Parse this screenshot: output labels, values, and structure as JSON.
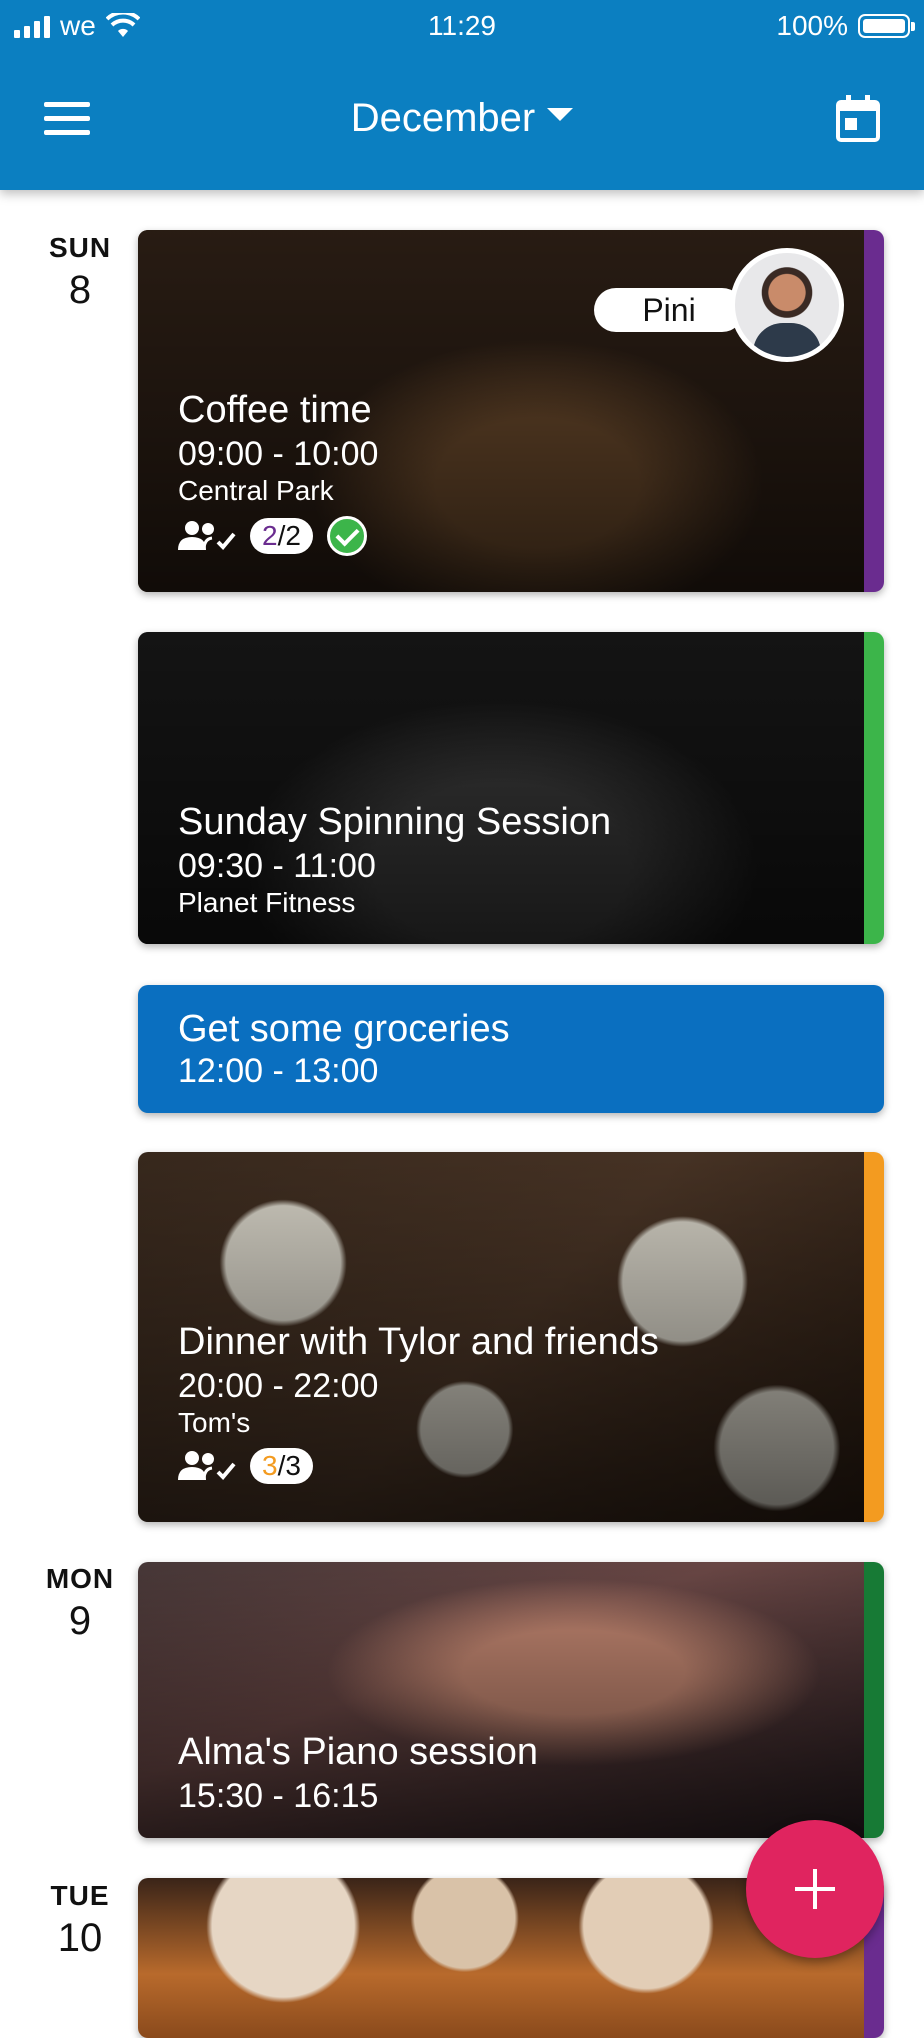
{
  "status_bar": {
    "carrier": "we",
    "time": "11:29",
    "battery": "100%"
  },
  "header": {
    "month": "December",
    "menu_icon": "menu-icon",
    "calendar_icon": "calendar-icon"
  },
  "days": [
    {
      "dow": "SUN",
      "num": "8"
    },
    {
      "dow": "MON",
      "num": "9"
    },
    {
      "dow": "TUE",
      "num": "10"
    }
  ],
  "events": [
    {
      "title": "Coffee time",
      "time": "09:00 - 10:00",
      "place": "Central Park",
      "owner": "Pini",
      "attendees_going": "2",
      "attendees_total": "/2",
      "color": "#6a2c8f"
    },
    {
      "title": "Sunday Spinning Session",
      "time": "09:30 - 11:00",
      "place": "Planet Fitness",
      "color": "#3cb54a"
    },
    {
      "title": "Get some groceries",
      "time": "12:00 - 13:00",
      "color": "#0a6fc0"
    },
    {
      "title": "Dinner with Tylor and friends",
      "time": "20:00 - 22:00",
      "place": "Tom's",
      "attendees_going": "3",
      "attendees_total": "/3",
      "color": "#f39b20"
    },
    {
      "title": "Alma's Piano session",
      "time": "15:30 - 16:15",
      "color": "#177a35"
    }
  ],
  "fab": {
    "icon": "plus-icon"
  }
}
